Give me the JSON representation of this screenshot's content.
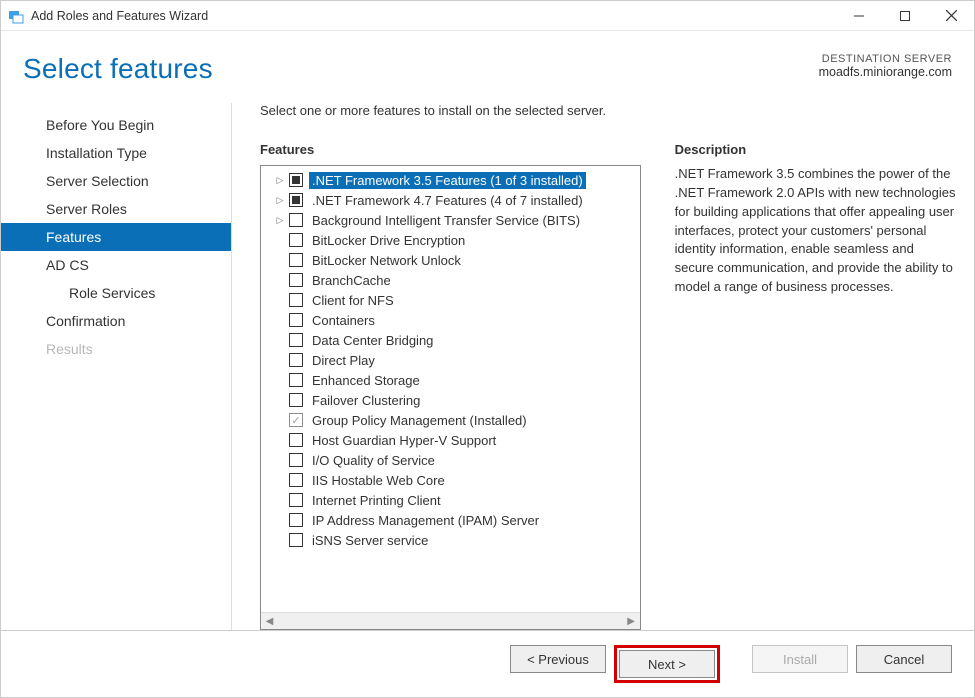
{
  "window": {
    "title": "Add Roles and Features Wizard"
  },
  "header": {
    "page_title": "Select features",
    "destination_label": "DESTINATION SERVER",
    "destination_server": "moadfs.miniorange.com"
  },
  "nav": {
    "items": [
      {
        "label": "Before You Begin",
        "active": false,
        "disabled": false,
        "indent": false
      },
      {
        "label": "Installation Type",
        "active": false,
        "disabled": false,
        "indent": false
      },
      {
        "label": "Server Selection",
        "active": false,
        "disabled": false,
        "indent": false
      },
      {
        "label": "Server Roles",
        "active": false,
        "disabled": false,
        "indent": false
      },
      {
        "label": "Features",
        "active": true,
        "disabled": false,
        "indent": false
      },
      {
        "label": "AD CS",
        "active": false,
        "disabled": false,
        "indent": false
      },
      {
        "label": "Role Services",
        "active": false,
        "disabled": false,
        "indent": true
      },
      {
        "label": "Confirmation",
        "active": false,
        "disabled": false,
        "indent": false
      },
      {
        "label": "Results",
        "active": false,
        "disabled": true,
        "indent": false
      }
    ]
  },
  "main": {
    "instruction": "Select one or more features to install on the selected server.",
    "features_label": "Features",
    "description_label": "Description",
    "description_text": ".NET Framework 3.5 combines the power of the .NET Framework 2.0 APIs with new technologies for building applications that offer appealing user interfaces, protect your customers' personal identity information, enable seamless and secure communication, and provide the ability to model a range of business processes.",
    "features": [
      {
        "label": ".NET Framework 3.5 Features (1 of 3 installed)",
        "state": "partial",
        "expandable": true,
        "selected": true
      },
      {
        "label": ".NET Framework 4.7 Features (4 of 7 installed)",
        "state": "partial",
        "expandable": true,
        "selected": false
      },
      {
        "label": "Background Intelligent Transfer Service (BITS)",
        "state": "unchecked",
        "expandable": true,
        "selected": false
      },
      {
        "label": "BitLocker Drive Encryption",
        "state": "unchecked",
        "expandable": false,
        "selected": false
      },
      {
        "label": "BitLocker Network Unlock",
        "state": "unchecked",
        "expandable": false,
        "selected": false
      },
      {
        "label": "BranchCache",
        "state": "unchecked",
        "expandable": false,
        "selected": false
      },
      {
        "label": "Client for NFS",
        "state": "unchecked",
        "expandable": false,
        "selected": false
      },
      {
        "label": "Containers",
        "state": "unchecked",
        "expandable": false,
        "selected": false
      },
      {
        "label": "Data Center Bridging",
        "state": "unchecked",
        "expandable": false,
        "selected": false
      },
      {
        "label": "Direct Play",
        "state": "unchecked",
        "expandable": false,
        "selected": false
      },
      {
        "label": "Enhanced Storage",
        "state": "unchecked",
        "expandable": false,
        "selected": false
      },
      {
        "label": "Failover Clustering",
        "state": "unchecked",
        "expandable": false,
        "selected": false
      },
      {
        "label": "Group Policy Management (Installed)",
        "state": "checked-disabled",
        "expandable": false,
        "selected": false
      },
      {
        "label": "Host Guardian Hyper-V Support",
        "state": "unchecked",
        "expandable": false,
        "selected": false
      },
      {
        "label": "I/O Quality of Service",
        "state": "unchecked",
        "expandable": false,
        "selected": false
      },
      {
        "label": "IIS Hostable Web Core",
        "state": "unchecked",
        "expandable": false,
        "selected": false
      },
      {
        "label": "Internet Printing Client",
        "state": "unchecked",
        "expandable": false,
        "selected": false
      },
      {
        "label": "IP Address Management (IPAM) Server",
        "state": "unchecked",
        "expandable": false,
        "selected": false
      },
      {
        "label": "iSNS Server service",
        "state": "unchecked",
        "expandable": false,
        "selected": false
      }
    ]
  },
  "footer": {
    "previous": "< Previous",
    "next": "Next >",
    "install": "Install",
    "cancel": "Cancel"
  }
}
